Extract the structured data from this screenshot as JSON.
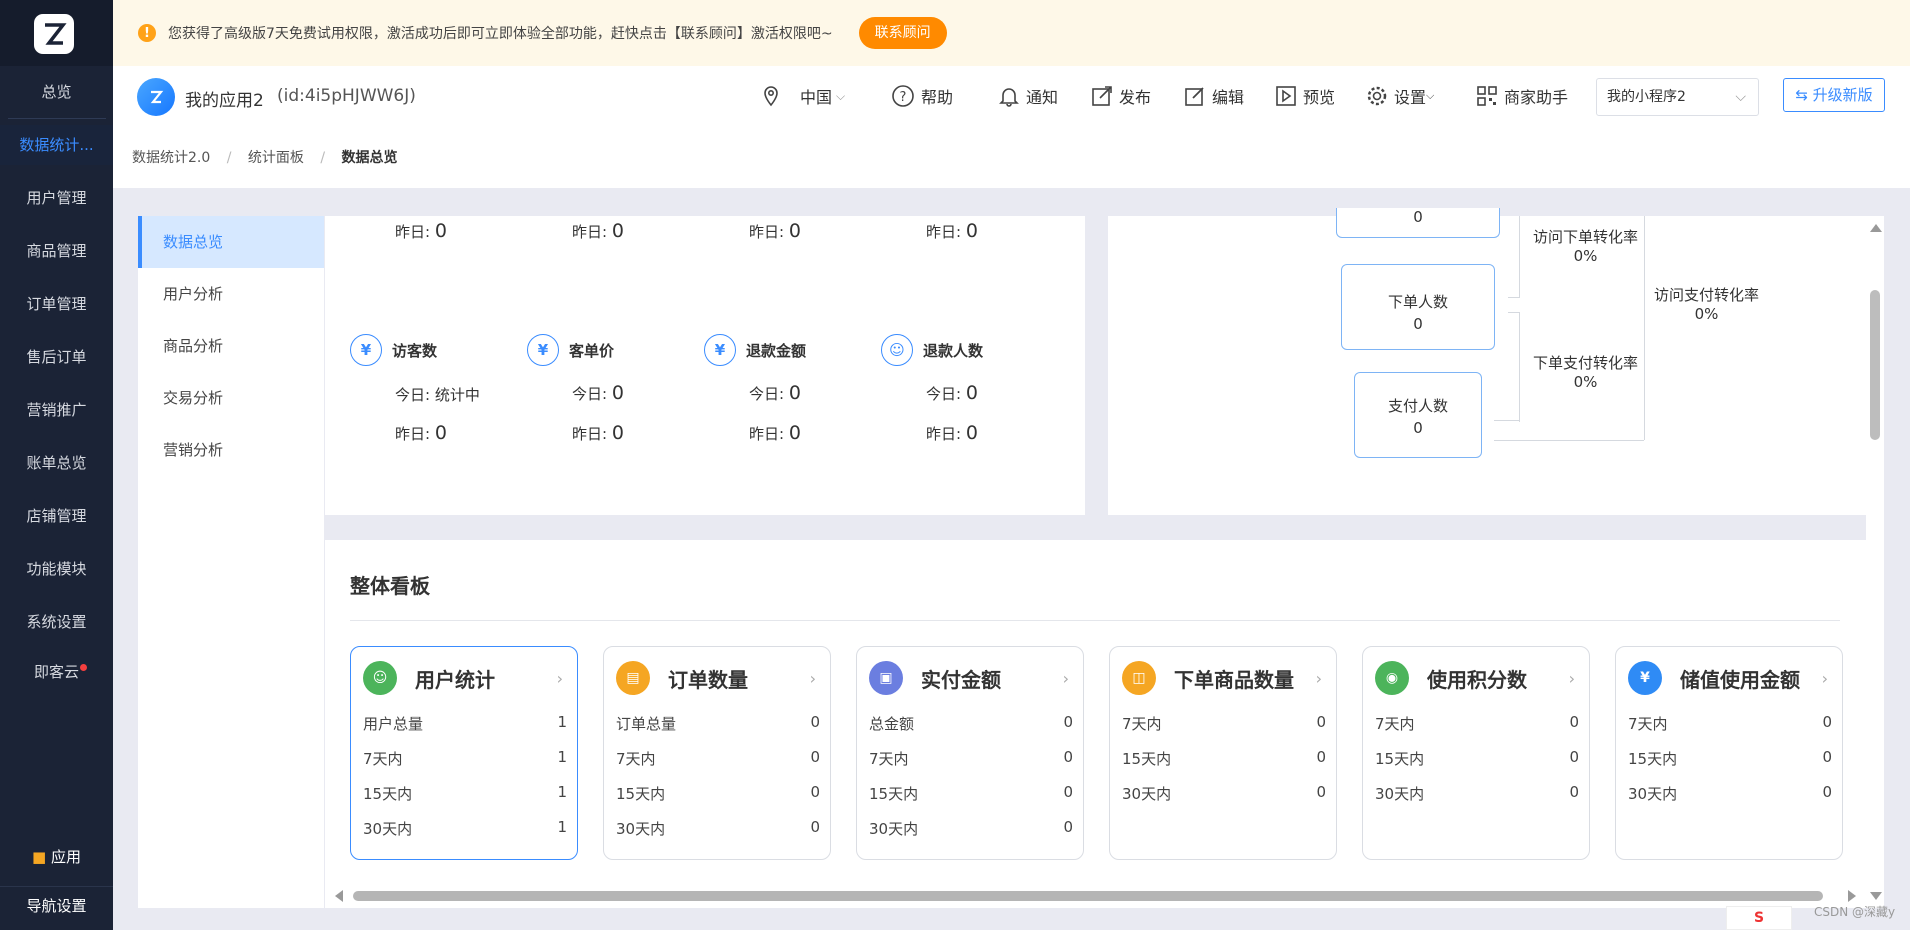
{
  "sidebar": {
    "items": [
      {
        "label": "总览"
      },
      {
        "label": "数据统计..."
      },
      {
        "label": "用户管理"
      },
      {
        "label": "商品管理"
      },
      {
        "label": "订单管理"
      },
      {
        "label": "售后订单"
      },
      {
        "label": "营销推广"
      },
      {
        "label": "账单总览"
      },
      {
        "label": "店铺管理"
      },
      {
        "label": "功能模块"
      },
      {
        "label": "系统设置"
      },
      {
        "label": "即客云"
      }
    ],
    "apps_label": "应用",
    "nav_settings_label": "导航设置"
  },
  "notice": {
    "text": "您获得了高级版7天免费试用权限，激活成功后即可立即体验全部功能，赶快点击【联系顾问】激活权限吧~",
    "button": "联系顾问"
  },
  "topbar": {
    "app_name": "我的应用2",
    "app_id": "(id:4i5pHJWW6J)",
    "region": "中国",
    "help": "帮助",
    "notify": "通知",
    "publish": "发布",
    "edit": "编辑",
    "preview": "预览",
    "settings": "设置",
    "merchant_helper": "商家助手",
    "miniapp_select": "我的小程序2",
    "upgrade": "升级新版"
  },
  "breadcrumb": [
    "数据统计2.0",
    "统计面板",
    "数据总览"
  ],
  "subnav": [
    "数据总览",
    "用户分析",
    "商品分析",
    "交易分析",
    "营销分析"
  ],
  "stats_top_yesterday": [
    {
      "label": "昨日:",
      "value": "0"
    },
    {
      "label": "昨日:",
      "value": "0"
    },
    {
      "label": "昨日:",
      "value": "0"
    },
    {
      "label": "昨日:",
      "value": "0"
    }
  ],
  "stats": [
    {
      "title": "访客数",
      "today_label": "今日:",
      "today": "统计中",
      "yest_label": "昨日:",
      "yest": "0"
    },
    {
      "title": "客单价",
      "today_label": "今日:",
      "today": "0",
      "yest_label": "昨日:",
      "yest": "0"
    },
    {
      "title": "退款金额",
      "today_label": "今日:",
      "today": "0",
      "yest_label": "昨日:",
      "yest": "0"
    },
    {
      "title": "退款人数",
      "today_label": "今日:",
      "today": "0",
      "yest_label": "昨日:",
      "yest": "0"
    }
  ],
  "funnel": {
    "top_value": "0",
    "order_people_label": "下单人数",
    "order_people_value": "0",
    "pay_people_label": "支付人数",
    "pay_people_value": "0",
    "visit_order_rate_label": "访问下单转化率",
    "visit_order_rate": "0%",
    "order_pay_rate_label": "下单支付转化率",
    "order_pay_rate": "0%",
    "visit_pay_rate_label": "访问支付转化率",
    "visit_pay_rate": "0%"
  },
  "board": {
    "title": "整体看板",
    "cards": [
      {
        "title": "用户统计",
        "color": "#4cb45b",
        "rows": [
          [
            "用户总量",
            "1"
          ],
          [
            "7天内",
            "1"
          ],
          [
            "15天内",
            "1"
          ],
          [
            "30天内",
            "1"
          ]
        ]
      },
      {
        "title": "订单数量",
        "color": "#f5a623",
        "rows": [
          [
            "订单总量",
            "0"
          ],
          [
            "7天内",
            "0"
          ],
          [
            "15天内",
            "0"
          ],
          [
            "30天内",
            "0"
          ]
        ]
      },
      {
        "title": "实付金额",
        "color": "#6b7ee0",
        "rows": [
          [
            "总金额",
            "0"
          ],
          [
            "7天内",
            "0"
          ],
          [
            "15天内",
            "0"
          ],
          [
            "30天内",
            "0"
          ]
        ]
      },
      {
        "title": "下单商品数量",
        "color": "#f5a623",
        "rows": [
          [
            "7天内",
            "0"
          ],
          [
            "15天内",
            "0"
          ],
          [
            "30天内",
            "0"
          ]
        ]
      },
      {
        "title": "使用积分数",
        "color": "#4cb45b",
        "rows": [
          [
            "7天内",
            "0"
          ],
          [
            "15天内",
            "0"
          ],
          [
            "30天内",
            "0"
          ]
        ]
      },
      {
        "title": "储值使用金额",
        "color": "#2f8bf5",
        "rows": [
          [
            "7天内",
            "0"
          ],
          [
            "15天内",
            "0"
          ],
          [
            "30天内",
            "0"
          ]
        ]
      }
    ]
  },
  "watermark": "CSDN @深藏y"
}
